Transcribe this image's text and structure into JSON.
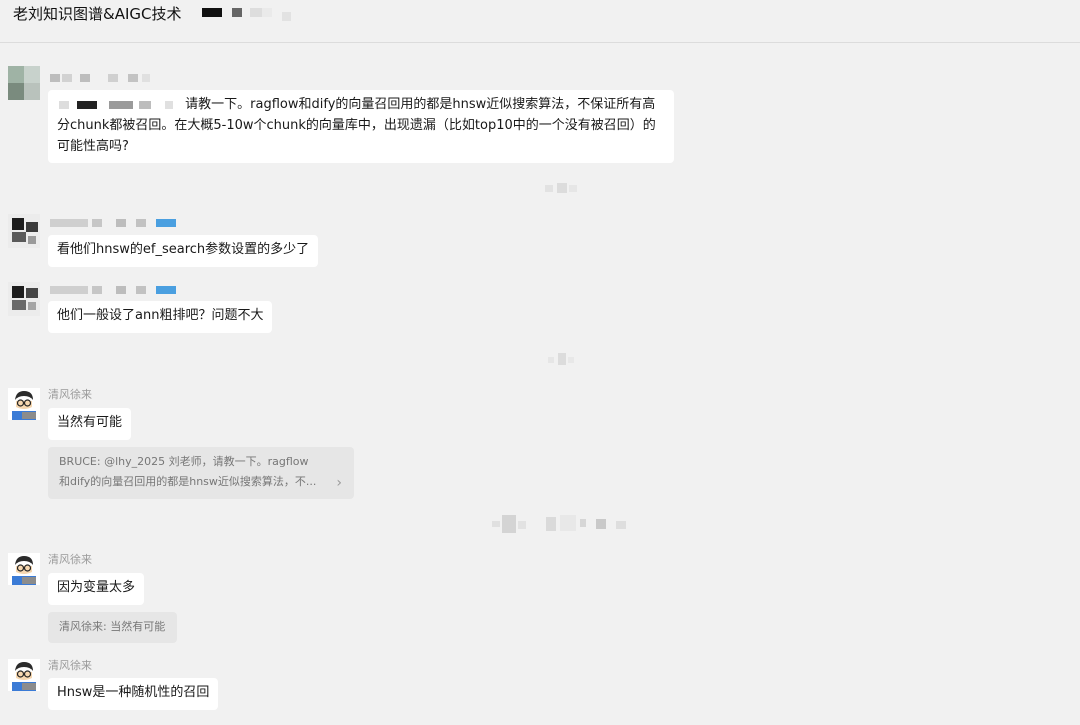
{
  "chat": {
    "title": "老刘知识图谱&AIGC技术"
  },
  "messages": [
    {
      "sender": "",
      "text": "请教一下。ragflow和dify的向量召回用的都是hnsw近似搜索算法，不保证所有高分chunk都被召回。在大概5-10w个chunk的向量库中，出现遗漏（比如top10中的一个没有被召回）的可能性高吗?"
    },
    {
      "sender": "",
      "text": "看他们hnsw的ef_search参数设置的多少了"
    },
    {
      "sender": "",
      "text": "他们一般设了ann粗排吧？问题不大"
    },
    {
      "sender": "清风徐来",
      "text": "当然有可能",
      "quote": "BRUCE: @lhy_2025 刘老师，请教一下。ragflow和dify的向量召回用的都是hnsw近似搜索算法，不..."
    },
    {
      "sender": "清风徐来",
      "text": "因为变量太多",
      "quote": "清风徐来: 当然有可能"
    },
    {
      "sender": "清风徐来",
      "text": "Hnsw是一种随机性的召回"
    }
  ],
  "icons": {
    "quote_chevron": "chevron-right-icon"
  },
  "colors": {
    "background": "#f1f1f1",
    "bubble": "#ffffff",
    "quote": "#e6e6e6",
    "name": "#9a9a9a"
  }
}
